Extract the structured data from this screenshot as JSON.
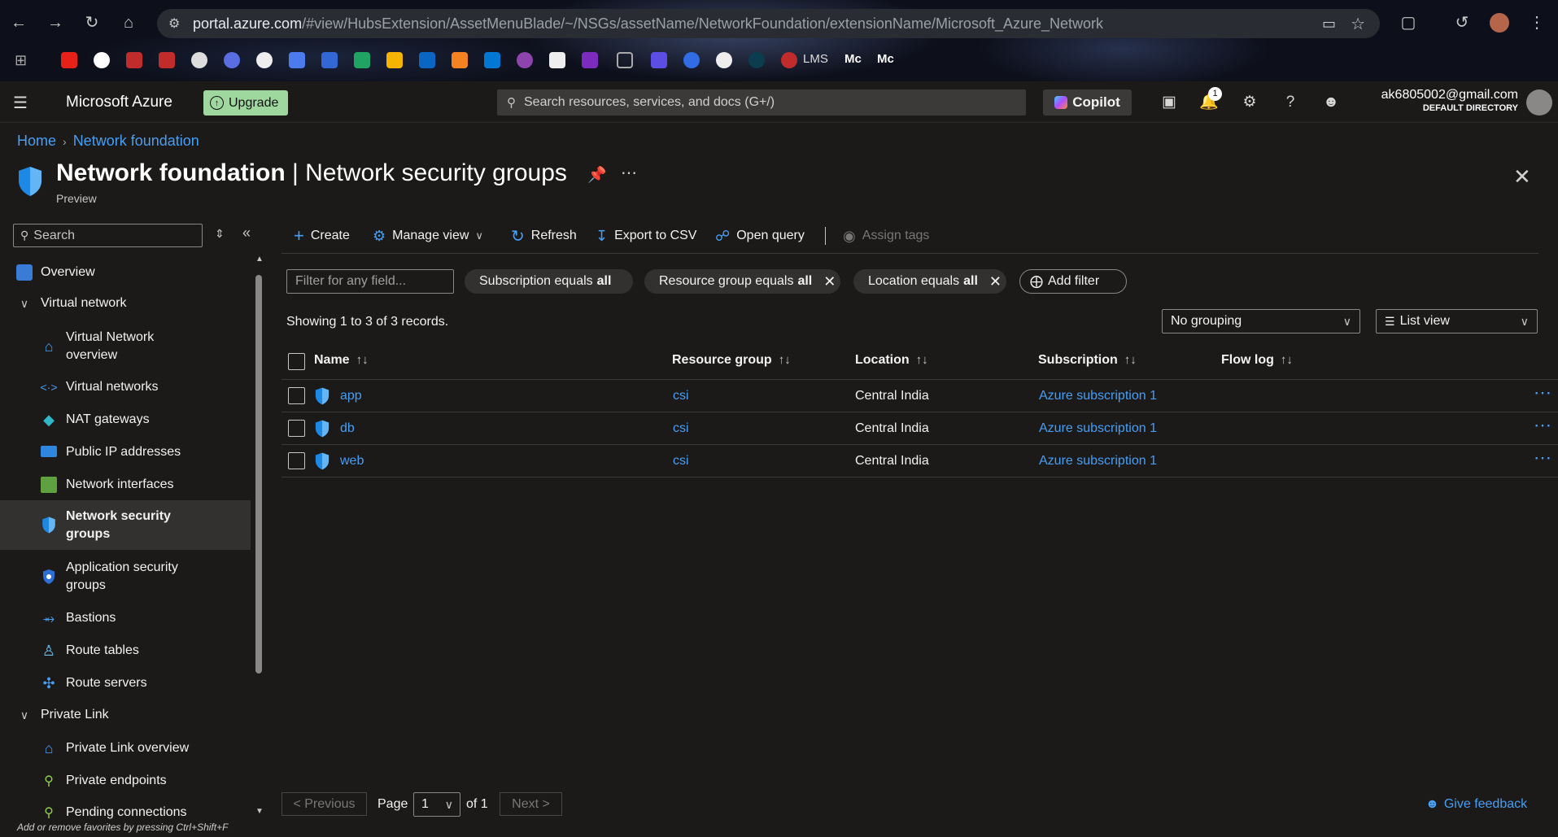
{
  "browser": {
    "url_host": "portal.azure.com",
    "url_path": "/#view/HubsExtension/AssetMenuBlade/~/NSGs/assetName/NetworkFoundation/extensionName/Microsoft_Azure_Network",
    "bookmarks": [
      "LMS",
      "Mc",
      "Mc"
    ]
  },
  "topbar": {
    "brand": "Microsoft Azure",
    "upgrade_label": "Upgrade",
    "search_placeholder": "Search resources, services, and docs (G+/)",
    "copilot_label": "Copilot",
    "notification_count": "1",
    "user_email": "ak6805002@gmail.com",
    "user_directory": "DEFAULT DIRECTORY"
  },
  "breadcrumb": {
    "home": "Home",
    "current": "Network foundation"
  },
  "page": {
    "title_bold": "Network foundation",
    "title_rest": " | Network security groups",
    "subtitle": "Preview"
  },
  "sidebar": {
    "search_placeholder": "Search",
    "items": [
      {
        "label": "Overview"
      },
      {
        "label": "Virtual network"
      },
      {
        "label": "Virtual Network overview"
      },
      {
        "label": "Virtual networks"
      },
      {
        "label": "NAT gateways"
      },
      {
        "label": "Public IP addresses"
      },
      {
        "label": "Network interfaces"
      },
      {
        "label": "Network security groups"
      },
      {
        "label": "Application security groups"
      },
      {
        "label": "Bastions"
      },
      {
        "label": "Route tables"
      },
      {
        "label": "Route servers"
      },
      {
        "label": "Private Link"
      },
      {
        "label": "Private Link overview"
      },
      {
        "label": "Private endpoints"
      },
      {
        "label": "Pending connections"
      }
    ],
    "footer_hint": "Add or remove favorites by pressing Ctrl+Shift+F"
  },
  "toolbar": {
    "create": "Create",
    "manage_view": "Manage view",
    "refresh": "Refresh",
    "export": "Export to CSV",
    "open_query": "Open query",
    "assign_tags": "Assign tags"
  },
  "filters": {
    "field_placeholder": "Filter for any field...",
    "subscription": {
      "label": "Subscription equals",
      "value": "all"
    },
    "resource_group": {
      "label": "Resource group equals",
      "value": "all"
    },
    "location": {
      "label": "Location equals",
      "value": "all"
    },
    "add_filter": "Add filter"
  },
  "records_text": "Showing 1 to 3 of 3 records.",
  "grouping": "No grouping",
  "view_mode": "List view",
  "table": {
    "headers": [
      "Name",
      "Resource group",
      "Location",
      "Subscription",
      "Flow log"
    ],
    "rows": [
      {
        "name": "app",
        "resource_group": "csi",
        "location": "Central India",
        "subscription": "Azure subscription 1"
      },
      {
        "name": "db",
        "resource_group": "csi",
        "location": "Central India",
        "subscription": "Azure subscription 1"
      },
      {
        "name": "web",
        "resource_group": "csi",
        "location": "Central India",
        "subscription": "Azure subscription 1"
      }
    ]
  },
  "pagination": {
    "previous": "< Previous",
    "page_label": "Page",
    "page_value": "1",
    "of_label": "of 1",
    "next": "Next >"
  },
  "feedback": "Give feedback",
  "colors": {
    "accent": "#479ef5",
    "upgrade_bg": "#9fd89f",
    "bg": "#1b1a19"
  }
}
